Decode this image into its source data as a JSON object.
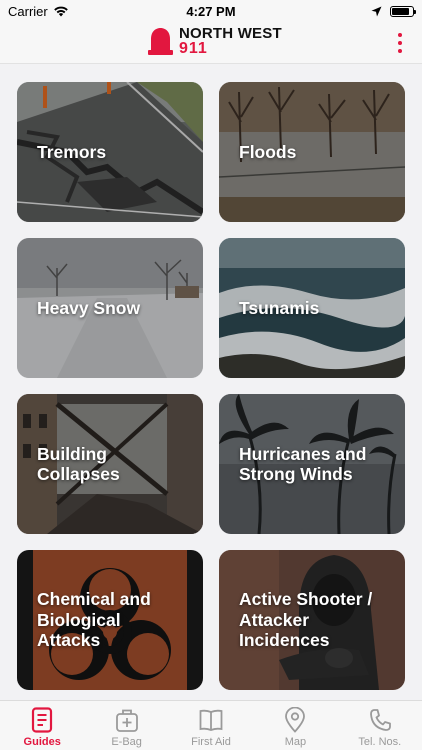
{
  "status_bar": {
    "carrier": "Carrier",
    "time": "4:27 PM",
    "battery_level": 0.85
  },
  "header": {
    "logo_line1": "NORTH WEST",
    "logo_line2": "911",
    "menu_icon": "more-vertical-icon"
  },
  "colors": {
    "accent": "#e2173f",
    "tab_inactive": "#9a9a9a"
  },
  "guides": [
    {
      "label": "Tremors",
      "image": "cracked-road-photo"
    },
    {
      "label": "Floods",
      "image": "flooded-field-photo"
    },
    {
      "label": "Heavy Snow",
      "image": "snowy-road-photo"
    },
    {
      "label": "Tsunamis",
      "image": "ocean-wave-photo"
    },
    {
      "label": "Building\nCollapses",
      "image": "collapsed-building-photo"
    },
    {
      "label": "Hurricanes and\nStrong Winds",
      "image": "palm-trees-storm-photo"
    },
    {
      "label": "Chemical and\nBiological\nAttacks",
      "image": "biohazard-symbol"
    },
    {
      "label": "Active Shooter /\nAttacker\nIncidences",
      "image": "hooded-attacker-photo"
    }
  ],
  "tabs": [
    {
      "label": "Guides",
      "icon": "document-icon",
      "active": true
    },
    {
      "label": "E-Bag",
      "icon": "medical-bag-icon",
      "active": false
    },
    {
      "label": "First Aid",
      "icon": "open-book-icon",
      "active": false
    },
    {
      "label": "Map",
      "icon": "map-pin-icon",
      "active": false
    },
    {
      "label": "Tel. Nos.",
      "icon": "phone-icon",
      "active": false
    }
  ]
}
